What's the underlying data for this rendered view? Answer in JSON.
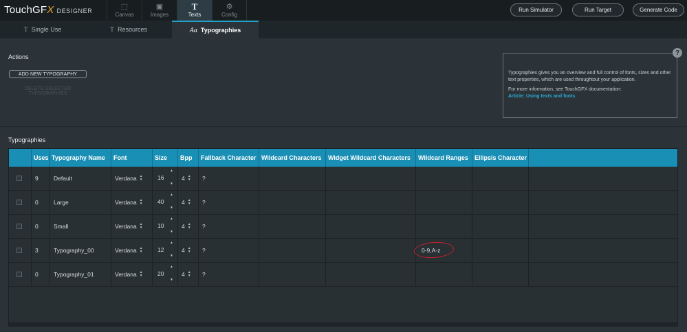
{
  "app": {
    "brand_main": "TouchGF",
    "brand_x": "X",
    "brand_suffix": "DESIGNER"
  },
  "nav": [
    {
      "label": "Canvas",
      "icon": "canvas-icon",
      "active": false
    },
    {
      "label": "Images",
      "icon": "images-icon",
      "active": false
    },
    {
      "label": "Texts",
      "icon": "texts-icon",
      "active": true
    },
    {
      "label": "Config",
      "icon": "config-icon",
      "active": false
    }
  ],
  "top_buttons": {
    "run_simulator": "Run Simulator",
    "run_target": "Run Target",
    "generate_code": "Generate Code"
  },
  "tabs": [
    {
      "label": "Single Use",
      "icon": "T",
      "active": false
    },
    {
      "label": "Resources",
      "icon": "T",
      "active": false
    },
    {
      "label": "Typographies",
      "icon": "Aa",
      "active": true
    }
  ],
  "actions": {
    "title": "Actions",
    "add_label": "ADD NEW TYPOGRAPHY",
    "delete_label": "DELETE SELECTED TYPOGRAPHIES"
  },
  "help": {
    "line1": "Typographies gives you an overview and full control of fonts, sizes and other text properties, which are used throughtout your application.",
    "line2": "For more information, see TouchGFX documentation:",
    "link": "Article: Using texts and fonts",
    "icon": "?"
  },
  "typographies_title": "Typographies",
  "table": {
    "headers": [
      "",
      "Uses",
      "Typography Name",
      "Font",
      "Size",
      "Bpp",
      "Fallback Character",
      "Wildcard Characters",
      "Widget Wildcard Characters",
      "Wildcard Ranges",
      "Ellipsis Character"
    ],
    "rows": [
      {
        "uses": "9",
        "name": "Default",
        "font": "Verdana",
        "size": "16",
        "bpp": "4",
        "fallback": "?",
        "wildcard": "",
        "widget_wildcard": "",
        "ranges": "",
        "ellipsis": ""
      },
      {
        "uses": "0",
        "name": "Large",
        "font": "Verdana",
        "size": "40",
        "bpp": "4",
        "fallback": "?",
        "wildcard": "",
        "widget_wildcard": "",
        "ranges": "",
        "ellipsis": ""
      },
      {
        "uses": "0",
        "name": "Small",
        "font": "Verdana",
        "size": "10",
        "bpp": "4",
        "fallback": "?",
        "wildcard": "",
        "widget_wildcard": "",
        "ranges": "",
        "ellipsis": ""
      },
      {
        "uses": "3",
        "name": "Typography_00",
        "font": "Verdana",
        "size": "12",
        "bpp": "4",
        "fallback": "?",
        "wildcard": "",
        "widget_wildcard": "",
        "ranges": "0-9,A-z",
        "ellipsis": ""
      },
      {
        "uses": "0",
        "name": "Typography_01",
        "font": "Verdana",
        "size": "20",
        "bpp": "4",
        "fallback": "?",
        "wildcard": "",
        "widget_wildcard": "",
        "ranges": "",
        "ellipsis": ""
      }
    ]
  },
  "colors": {
    "accent": "#1a8fb5",
    "background": "#2b3338",
    "topbar": "#181d20",
    "annotation": "#c8202a"
  }
}
